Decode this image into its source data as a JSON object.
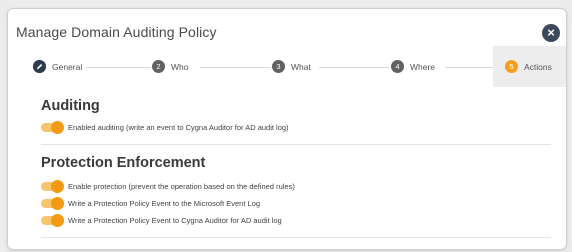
{
  "dialog": {
    "title": "Manage Domain Auditing Policy",
    "close_glyph": "×"
  },
  "stepper": {
    "steps": [
      {
        "number": "",
        "icon": "pencil-icon",
        "label": "General"
      },
      {
        "number": "2",
        "label": "Who"
      },
      {
        "number": "3",
        "label": "What"
      },
      {
        "number": "4",
        "label": "Where"
      },
      {
        "number": "5",
        "label": "Actions"
      }
    ],
    "active_step": 5
  },
  "auditing": {
    "title": "Auditing",
    "toggles": [
      {
        "label": "Enabled auditing (write an event to Cygna Auditor for AD audit log)",
        "on": true
      }
    ]
  },
  "protection": {
    "title": "Protection Enforcement",
    "toggles": [
      {
        "label": "Enable protection (prevent the operation based on the defined rules)",
        "on": true
      },
      {
        "label": "Write a Protection Policy Event to the Microsoft Event Log",
        "on": true
      },
      {
        "label": "Write a Protection Policy Event to Cygna Auditor for AD audit log",
        "on": true
      }
    ]
  },
  "colors": {
    "accent": "#f29a12",
    "toggle_track": "#f7c36b",
    "close_button": "#3d4a5c"
  }
}
